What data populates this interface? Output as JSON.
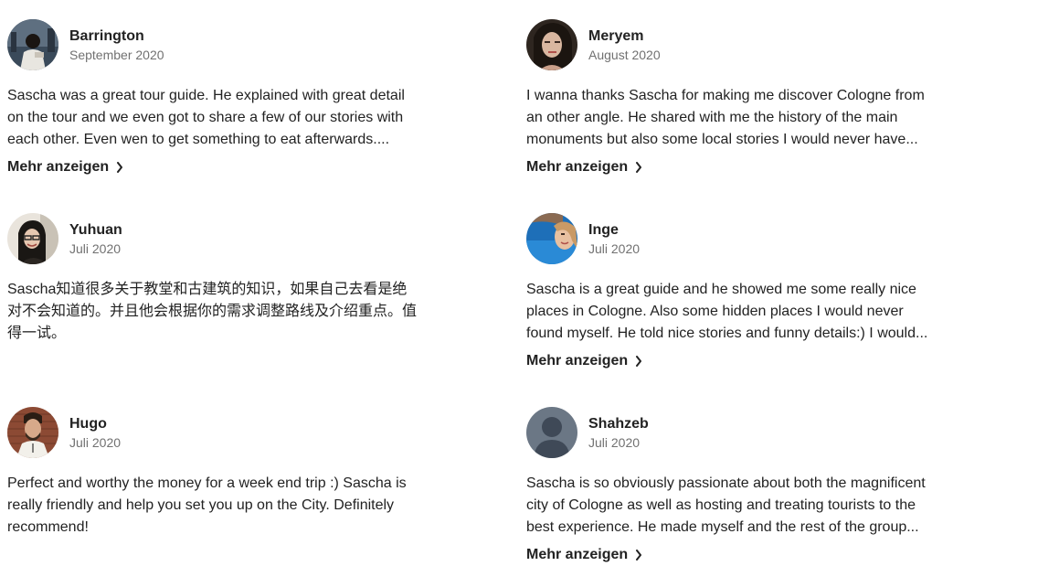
{
  "more_label": "Mehr anzeigen",
  "reviews": [
    {
      "name": "Barrington",
      "date": "September 2020",
      "text": "Sascha was a great tour guide. He explained with great detail on the tour and we even got to share a few of our stories with each other. Even wen to get something to eat afterwards....",
      "has_more": true,
      "avatar": "photo-man-dark-city"
    },
    {
      "name": "Meryem",
      "date": "August 2020",
      "text": "I wanna thanks Sascha for making me discover Cologne from an other angle. He shared with me the history of the main monuments but also some local stories I would never have...",
      "has_more": true,
      "avatar": "photo-woman-dark-hair"
    },
    {
      "name": "Yuhuan",
      "date": "Juli 2020",
      "text": "Sascha知道很多关于教堂和古建筑的知识，如果自己去看是绝对不会知道的。并且他会根据你的需求调整路线及介绍重点。值得一试。",
      "has_more": false,
      "avatar": "photo-woman-glasses"
    },
    {
      "name": "Inge",
      "date": "Juli 2020",
      "text": "Sascha is a great guide and he showed me some really nice places in Cologne. Also some hidden places I would never found myself. He told nice stories and funny details:) I would...",
      "has_more": true,
      "avatar": "photo-woman-blue-water"
    },
    {
      "name": "Hugo",
      "date": "Juli 2020",
      "text": "Perfect and worthy the money for a week end trip :) Sascha is really friendly and help you set you up on the City. Definitely recommend!",
      "has_more": false,
      "avatar": "photo-man-brick-wall"
    },
    {
      "name": "Shahzeb",
      "date": "Juli 2020",
      "text": "Sascha is so obviously passionate about both the magnificent city of Cologne as well as hosting and treating tourists to the best experience. He made myself and the rest of the group...",
      "has_more": true,
      "avatar": "default-user-icon"
    }
  ]
}
